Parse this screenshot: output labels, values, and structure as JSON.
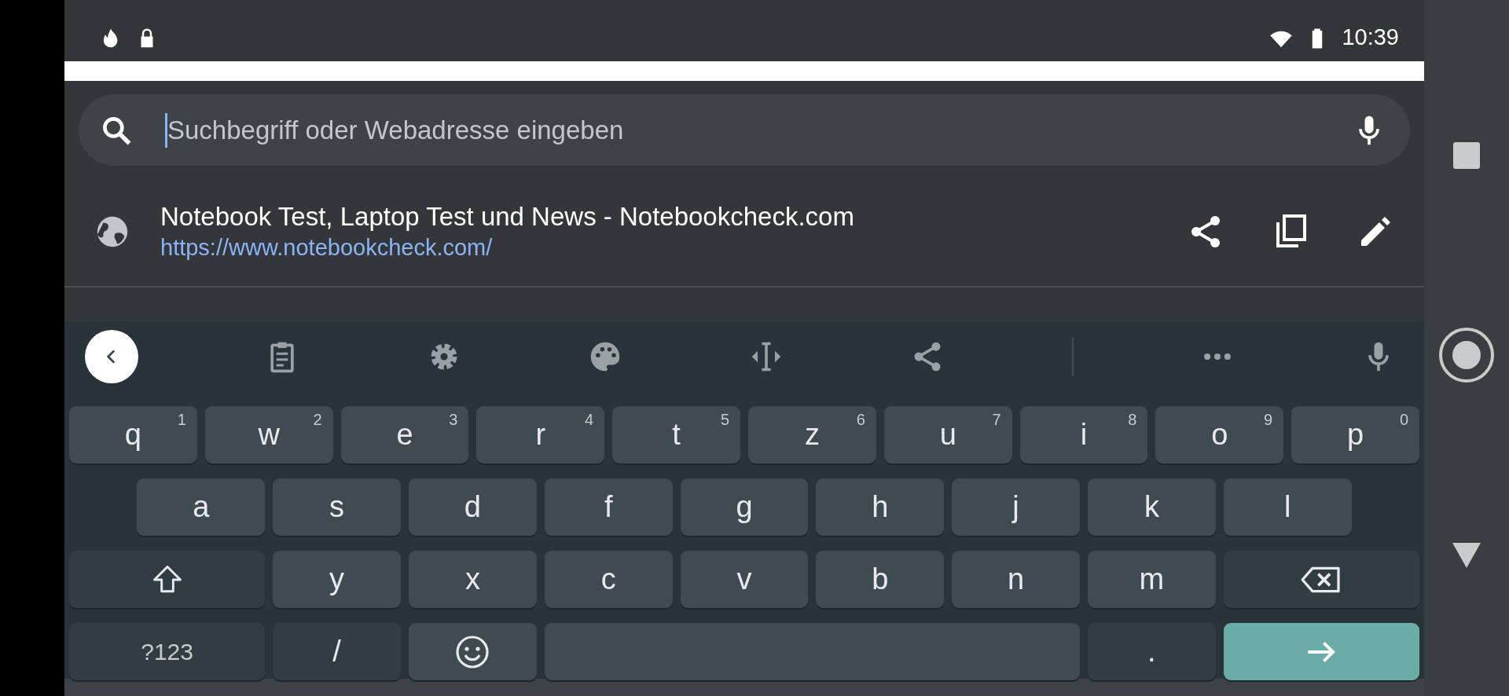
{
  "status_bar": {
    "time": "10:39"
  },
  "search": {
    "placeholder": "Suchbegriff oder Webadresse eingeben"
  },
  "suggestions": [
    {
      "title": "Notebook Test, Laptop Test und News - Notebookcheck.com",
      "url": "https://www.notebookcheck.com/"
    }
  ],
  "keyboard": {
    "key_rows": [
      {
        "keys": [
          {
            "kind": "letter",
            "label": "q",
            "hint": "1"
          },
          {
            "kind": "letter",
            "label": "w",
            "hint": "2"
          },
          {
            "kind": "letter",
            "label": "e",
            "hint": "3"
          },
          {
            "kind": "letter",
            "label": "r",
            "hint": "4"
          },
          {
            "kind": "letter",
            "label": "t",
            "hint": "5"
          },
          {
            "kind": "letter",
            "label": "z",
            "hint": "6"
          },
          {
            "kind": "letter",
            "label": "u",
            "hint": "7"
          },
          {
            "kind": "letter",
            "label": "i",
            "hint": "8"
          },
          {
            "kind": "letter",
            "label": "o",
            "hint": "9"
          },
          {
            "kind": "letter",
            "label": "p",
            "hint": "0"
          }
        ]
      },
      {
        "keys": [
          {
            "kind": "letter",
            "label": "a"
          },
          {
            "kind": "letter",
            "label": "s"
          },
          {
            "kind": "letter",
            "label": "d"
          },
          {
            "kind": "letter",
            "label": "f"
          },
          {
            "kind": "letter",
            "label": "g"
          },
          {
            "kind": "letter",
            "label": "h"
          },
          {
            "kind": "letter",
            "label": "j"
          },
          {
            "kind": "letter",
            "label": "k"
          },
          {
            "kind": "letter",
            "label": "l"
          }
        ]
      },
      {
        "keys": [
          {
            "kind": "shift"
          },
          {
            "kind": "letter",
            "label": "y"
          },
          {
            "kind": "letter",
            "label": "x"
          },
          {
            "kind": "letter",
            "label": "c"
          },
          {
            "kind": "letter",
            "label": "v"
          },
          {
            "kind": "letter",
            "label": "b"
          },
          {
            "kind": "letter",
            "label": "n"
          },
          {
            "kind": "letter",
            "label": "m"
          },
          {
            "kind": "backspace"
          }
        ]
      },
      {
        "keys": [
          {
            "kind": "symbols",
            "label": "?123"
          },
          {
            "kind": "char",
            "label": "/"
          },
          {
            "kind": "emoji"
          },
          {
            "kind": "space"
          },
          {
            "kind": "punct",
            "label": "."
          },
          {
            "kind": "enter"
          }
        ]
      }
    ]
  }
}
